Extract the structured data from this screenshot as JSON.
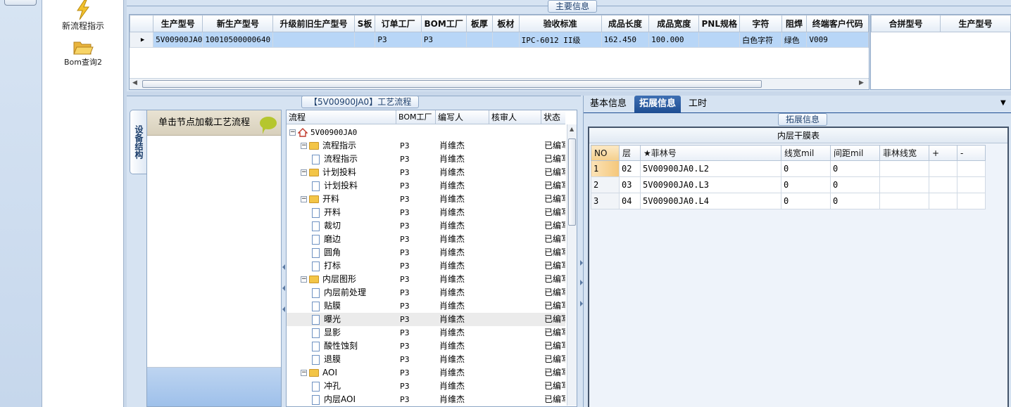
{
  "nav": {
    "items": [
      {
        "label": "新流程指示",
        "icon": "lightning-icon"
      },
      {
        "label": "Bom查询2",
        "icon": "open-folder-icon"
      }
    ]
  },
  "main_info": {
    "title": "主要信息",
    "columns": [
      "生产型号",
      "新生产型号",
      "升级前旧生产型号",
      "S板",
      "订单工厂",
      "BOM工厂",
      "板厚",
      "板材",
      "验收标准",
      "成品长度",
      "成品宽度",
      "PNL规格",
      "字符",
      "阻焊",
      "终端客户代码"
    ],
    "rows": [
      [
        "5V00900JA0",
        "10010500000640",
        "",
        "",
        "P3",
        "P3",
        "",
        "",
        "IPC-6012 II级",
        "162.450",
        "100.000",
        "",
        "白色字符",
        "绿色",
        "V009"
      ]
    ],
    "side_columns": [
      "合拼型号",
      "生产型号"
    ]
  },
  "flow": {
    "title": "【5V00900JA0】工艺流程",
    "side_tab": "设备结构",
    "equipment_header": "单击节点加载工艺流程",
    "columns": [
      "流程",
      "BOM工厂",
      "编写人",
      "核审人",
      "状态"
    ],
    "tree": [
      {
        "level": 0,
        "type": "home",
        "name": "5V00900JA0",
        "factory": "",
        "author": "",
        "reviewer": "",
        "status": ""
      },
      {
        "level": 1,
        "type": "folder",
        "name": "流程指示",
        "factory": "P3",
        "author": "肖维杰",
        "reviewer": "",
        "status": "已编写"
      },
      {
        "level": 2,
        "type": "doc",
        "name": "流程指示",
        "factory": "P3",
        "author": "肖维杰",
        "reviewer": "",
        "status": "已编写"
      },
      {
        "level": 1,
        "type": "folder",
        "name": "计划投料",
        "factory": "P3",
        "author": "肖维杰",
        "reviewer": "",
        "status": "已编写"
      },
      {
        "level": 2,
        "type": "doc",
        "name": "计划投料",
        "factory": "P3",
        "author": "肖维杰",
        "reviewer": "",
        "status": "已编写"
      },
      {
        "level": 1,
        "type": "folder",
        "name": "开料",
        "factory": "P3",
        "author": "肖维杰",
        "reviewer": "",
        "status": "已编写"
      },
      {
        "level": 2,
        "type": "doc",
        "name": "开料",
        "factory": "P3",
        "author": "肖维杰",
        "reviewer": "",
        "status": "已编写"
      },
      {
        "level": 2,
        "type": "doc",
        "name": "裁切",
        "factory": "P3",
        "author": "肖维杰",
        "reviewer": "",
        "status": "已编写"
      },
      {
        "level": 2,
        "type": "doc",
        "name": "磨边",
        "factory": "P3",
        "author": "肖维杰",
        "reviewer": "",
        "status": "已编写"
      },
      {
        "level": 2,
        "type": "doc",
        "name": "圆角",
        "factory": "P3",
        "author": "肖维杰",
        "reviewer": "",
        "status": "已编写"
      },
      {
        "level": 2,
        "type": "doc",
        "name": "打标",
        "factory": "P3",
        "author": "肖维杰",
        "reviewer": "",
        "status": "已编写"
      },
      {
        "level": 1,
        "type": "folder",
        "name": "内层图形",
        "factory": "P3",
        "author": "肖维杰",
        "reviewer": "",
        "status": "已编写"
      },
      {
        "level": 2,
        "type": "doc",
        "name": "内层前处理",
        "factory": "P3",
        "author": "肖维杰",
        "reviewer": "",
        "status": "已编写"
      },
      {
        "level": 2,
        "type": "doc",
        "name": "贴膜",
        "factory": "P3",
        "author": "肖维杰",
        "reviewer": "",
        "status": "已编写"
      },
      {
        "level": 2,
        "type": "doc",
        "name": "曝光",
        "factory": "P3",
        "author": "肖维杰",
        "reviewer": "",
        "status": "已编写",
        "highlight": true
      },
      {
        "level": 2,
        "type": "doc",
        "name": "显影",
        "factory": "P3",
        "author": "肖维杰",
        "reviewer": "",
        "status": "已编写"
      },
      {
        "level": 2,
        "type": "doc",
        "name": "酸性蚀刻",
        "factory": "P3",
        "author": "肖维杰",
        "reviewer": "",
        "status": "已编写"
      },
      {
        "level": 2,
        "type": "doc",
        "name": "退膜",
        "factory": "P3",
        "author": "肖维杰",
        "reviewer": "",
        "status": "已编写"
      },
      {
        "level": 1,
        "type": "folder",
        "name": "AOI",
        "factory": "P3",
        "author": "肖维杰",
        "reviewer": "",
        "status": "已编写"
      },
      {
        "level": 2,
        "type": "doc",
        "name": "冲孔",
        "factory": "P3",
        "author": "肖维杰",
        "reviewer": "",
        "status": "已编写"
      },
      {
        "level": 2,
        "type": "doc",
        "name": "内层AOI",
        "factory": "P3",
        "author": "肖维杰",
        "reviewer": "",
        "status": "已编写"
      }
    ]
  },
  "right": {
    "tabs": [
      {
        "label": "基本信息",
        "active": false
      },
      {
        "label": "拓展信息",
        "active": true
      },
      {
        "label": "工时",
        "active": false
      }
    ],
    "ext_title": "拓展信息",
    "table_title": "内层干膜表",
    "columns": [
      "NO",
      "层",
      "★菲林号",
      "线宽mil",
      "间距mil",
      "菲林线宽",
      "+",
      "-"
    ],
    "rows": [
      [
        "1",
        "02",
        "5V00900JA0.L2",
        "0",
        "0",
        "",
        "",
        ""
      ],
      [
        "2",
        "03",
        "5V00900JA0.L3",
        "0",
        "0",
        "",
        "",
        ""
      ],
      [
        "3",
        "04",
        "5V00900JA0.L4",
        "0",
        "0",
        "",
        "",
        ""
      ]
    ]
  },
  "colors": {
    "accent": "#1f4e93",
    "selection": "#b8d6f7",
    "frame": "#d6e3f2"
  }
}
